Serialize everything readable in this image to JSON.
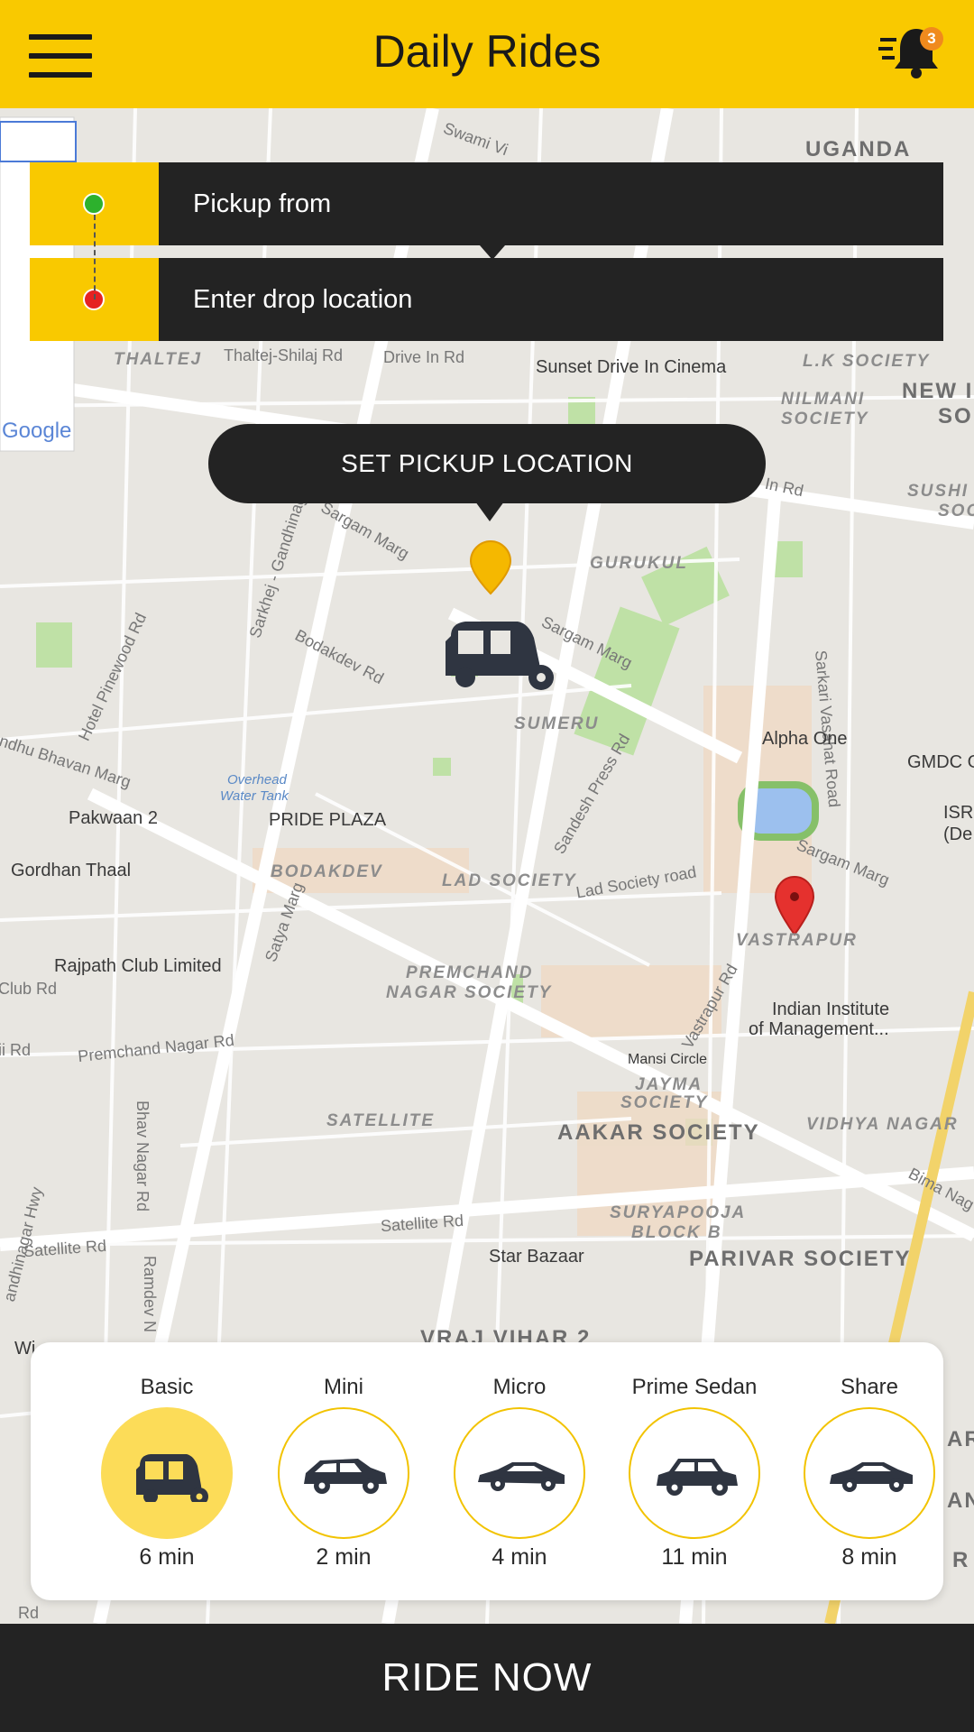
{
  "header": {
    "title": "Daily Rides",
    "menu_icon": "hamburger-menu-icon",
    "notification_icon": "bell-icon",
    "notification_count": "3",
    "background_color": "#f9c900"
  },
  "locations": {
    "pickup_placeholder": "Pickup from",
    "drop_placeholder": "Enter drop location",
    "pickup_dot_color": "#2db12d",
    "drop_dot_color": "#e52222"
  },
  "map": {
    "pickup_button": "SET PICKUP LOCATION",
    "google_logo": "Google",
    "labels": {
      "uganda": "UGANDA",
      "swami": "Swami Vi",
      "thaltej": "THALTEJ",
      "thaltej_road": "Thaltej-Shilaj Rd",
      "drive_in": "Drive In Rd",
      "sunset": "Sunset Drive In Cinema",
      "lk_society": "L.K SOCIETY",
      "nilmani": "NILMANI",
      "nilmani2": "SOCIETY",
      "new": "NEW I",
      "so": "SO",
      "in_rd": "In Rd",
      "sushi": "SUSHI",
      "soc": "SOC",
      "sargam1": "Sargam Marg",
      "sarkhej": "Sarkhej - Gandhinagar",
      "gurukul": "GURUKUL",
      "bodakdev_rd": "Bodakdev Rd",
      "hotel_pinewood": "Hotel Pinewood Rd",
      "sargam2": "Sargam Marg",
      "sarkari": "Sarkari Vasahat Road",
      "sumeru": "SUMERU",
      "sandesh": "Sandesh Press Rd",
      "alpha_one": "Alpha One",
      "gmdc": "GMDC G",
      "bhavan": "ndhu Bhavan Marg",
      "overhead": "Overhead",
      "water_tank": "Water Tank",
      "pakwaan": "Pakwaan 2",
      "pride": "PRIDE PLAZA",
      "isr": "ISR",
      "de": "(De",
      "sargam3": "Sargam Marg",
      "gordhan": "Gordhan Thaal",
      "bodakdev": "BODAKDEV",
      "lad_society": "LAD SOCIETY",
      "lad_rd": "Lad Society road",
      "vastrapur": "VASTRAPUR",
      "satya": "Satya Marg",
      "rajpath": "Rajpath Club Limited",
      "club_rd": "Club Rd",
      "premchand": "PREMCHAND",
      "nagar_society": "NAGAR SOCIETY",
      "vastrapur_rd": "Vastrapur Rd",
      "iim": "Indian Institute",
      "iim2": "of Management...",
      "ii_rd": "ii Rd",
      "premchand_rd": "Premchand Nagar Rd",
      "mansi": "Mansi Circle",
      "jayma": "JAYMA",
      "jayma2": "SOCIETY",
      "satellite": "SATELLITE",
      "aakar": "AAKAR SOCIETY",
      "vidhya": "VIDHYA NAGAR",
      "bhav_nagar": "Bhav Nagar Rd",
      "gandhinagar_hwy": "andhinagar Hwy",
      "bima": "Bima Nag",
      "satellite_rd": "Satellite Rd",
      "satellite_rd2": "Satellite Rd",
      "suryapooja": "SURYAPOOJA",
      "block_b": "BLOCK B",
      "star_bazaar": "Star Bazaar",
      "parivar": "PARIVAR SOCIETY",
      "ramdev": "Ramdev N",
      "vrajvihar": "VRAJ VIHAR 2",
      "w": "Wi",
      "ar": "AR",
      "an": "AN",
      "r": "R",
      "rd": "Rd"
    }
  },
  "vehicles": [
    {
      "name": "Basic",
      "time": "6 min",
      "icon": "auto-rickshaw-icon",
      "selected": true
    },
    {
      "name": "Mini",
      "time": "2 min",
      "icon": "mini-car-icon",
      "selected": false
    },
    {
      "name": "Micro",
      "time": "4 min",
      "icon": "micro-car-icon",
      "selected": false
    },
    {
      "name": "Prime Sedan",
      "time": "11 min",
      "icon": "sedan-car-icon",
      "selected": false
    },
    {
      "name": "Share",
      "time": "8 min",
      "icon": "share-car-icon",
      "selected": false
    }
  ],
  "ride_now": "RIDE NOW",
  "colors": {
    "accent": "#f9c900",
    "dark": "#232323",
    "selected_circle": "#fcdc58"
  }
}
